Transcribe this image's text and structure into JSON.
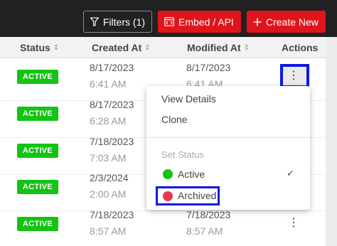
{
  "toolbar": {
    "filters_label": "Filters (1)",
    "embed_label": "Embed / API",
    "create_label": "Create New",
    "accent_color": "#e0141b"
  },
  "table": {
    "headers": {
      "status": "Status",
      "created": "Created At",
      "modified": "Modified At",
      "actions": "Actions"
    },
    "rows": [
      {
        "status": "ACTIVE",
        "created_date": "8/17/2023",
        "created_time": "6:41 AM",
        "modified_date": "8/17/2023",
        "modified_time": "6:41 AM"
      },
      {
        "status": "ACTIVE",
        "created_date": "8/17/2023",
        "created_time": "6:28 AM",
        "modified_date": "",
        "modified_time": ""
      },
      {
        "status": "ACTIVE",
        "created_date": "7/18/2023",
        "created_time": "7:03 AM",
        "modified_date": "",
        "modified_time": ""
      },
      {
        "status": "ACTIVE",
        "created_date": "2/3/2024",
        "created_time": "2:00 AM",
        "modified_date": "",
        "modified_time": ""
      },
      {
        "status": "ACTIVE",
        "created_date": "7/18/2023",
        "created_time": "8:57 AM",
        "modified_date": "7/18/2023",
        "modified_time": "8:57 AM"
      }
    ],
    "status_color": "#14c314"
  },
  "actions_menu": {
    "view_details": "View Details",
    "clone": "Clone",
    "section_label": "Set Status",
    "options": [
      {
        "label": "Active",
        "color": "#14c314",
        "selected": true,
        "check": "✓"
      },
      {
        "label": "Archived",
        "color": "#e8365a",
        "selected": false
      }
    ]
  },
  "icons": {
    "filter": "filter-icon",
    "embed": "embed-icon",
    "plus": "plus-icon",
    "sort": "sort-icon",
    "kebab": "kebab-menu-icon",
    "check": "checkmark-icon"
  }
}
